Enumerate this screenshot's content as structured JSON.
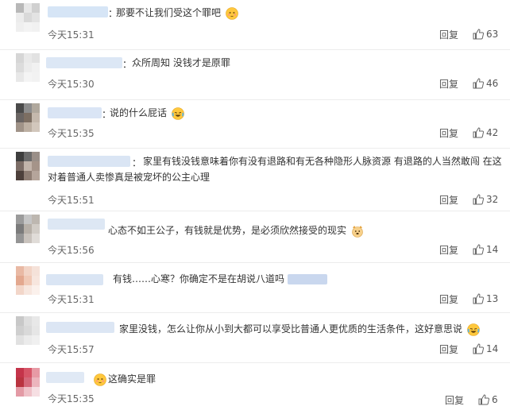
{
  "reply_label": "回复",
  "comments": [
    {
      "name_color": "#cfe0f5",
      "avatar": [
        "#b8b8b8",
        "#e7e7e7",
        "#d0d0d0",
        "#ececec",
        "#d9d9d9",
        "#e3e3e3",
        "#efefef",
        "#f3f3f3",
        "#f1f1f1"
      ],
      "colon": "：",
      "text": "那要不让我们受这个罪吧",
      "emoji": "blush",
      "time": "今天15:31",
      "likes": "63"
    },
    {
      "name_color": "#d6e3f3",
      "avatar": [
        "#d6d6d6",
        "#e9e9e9",
        "#e2e2e2",
        "#dcdcdc",
        "#ececec",
        "#f1f1f1",
        "#e8e8e8",
        "#f4f4f4",
        "#f2f2f2"
      ],
      "colon": "：",
      "text": "众所周知 没钱才是原罪",
      "emoji": "",
      "time": "今天15:30",
      "likes": "46"
    },
    {
      "name_color": "#d3e1f3",
      "avatar": [
        "#4a4a4a",
        "#8c8c8c",
        "#b0a89d",
        "#6a6563",
        "#7c6e62",
        "#c5b9ad",
        "#a09388",
        "#bdb0a3",
        "#d2c7bc"
      ],
      "colon": "：",
      "text": "说的什么屁话",
      "emoji": "cry",
      "time": "今天15:35",
      "likes": "42"
    },
    {
      "name_color": "#d4e1f2",
      "avatar": [
        "#3e3e3e",
        "#6b6b6b",
        "#9a8f88",
        "#7c6d66",
        "#c2b4aa",
        "#a59489",
        "#4d403b",
        "#8e7d73",
        "#b5a59b"
      ],
      "colon": "：",
      "text": "家里有钱没钱意味着你有没有退路和有无各种隐形人脉资源 有退路的人当然敢闯 在这对着普通人卖惨真是被宠坏的公主心理",
      "emoji": "",
      "time": "今天15:51",
      "likes": "32"
    },
    {
      "name_color": "#d7e3f2",
      "avatar": [
        "#9b9b9b",
        "#c5c5c5",
        "#bdb7b0",
        "#7b7b7b",
        "#b7b0a8",
        "#d1ccc6",
        "#959595",
        "#c9c3bd",
        "#e0dcd8"
      ],
      "colon": "",
      "text": "心态不如王公子，有钱就是优势，是必须欣然接受的现实",
      "emoji": "dog",
      "time": "今天15:56",
      "likes": "14"
    },
    {
      "name_color": "#d4e0f2",
      "avatar": [
        "#e9b9a4",
        "#f2d4c6",
        "#f5e2d9",
        "#e3a88f",
        "#f0c9b6",
        "#f7e6de",
        "#f2d6c9",
        "#f7e7df",
        "#fbf1ec"
      ],
      "colon": "",
      "text_before": "有钱……心寒？你确定不是在胡说八道吗",
      "emoji": "",
      "time": "今天15:31",
      "likes": "13"
    },
    {
      "name_color": "#d6e2f2",
      "avatar": [
        "#c8c8c8",
        "#dedede",
        "#e8e8e8",
        "#cfcfcf",
        "#d9d9d9",
        "#e6e6e6",
        "#e1e1e1",
        "#ebebeb",
        "#f0f0f0"
      ],
      "colon": "",
      "text": "家里没钱，怎么让你从小到大都可以享受比普通人更优质的生活条件，这好意思说",
      "emoji": "cry",
      "time": "今天15:57",
      "likes": "14"
    },
    {
      "name_color": "#dbe5f3",
      "avatar": [
        "#c4344a",
        "#d65567",
        "#e79aa5",
        "#b9333f",
        "#d4687a",
        "#ecb5bd",
        "#e39aa5",
        "#efc1c8",
        "#f6dfe3"
      ],
      "colon": "",
      "emoji_first": "blush",
      "text": "这确实是罪",
      "time": "今天15:35",
      "likes": "6"
    }
  ]
}
